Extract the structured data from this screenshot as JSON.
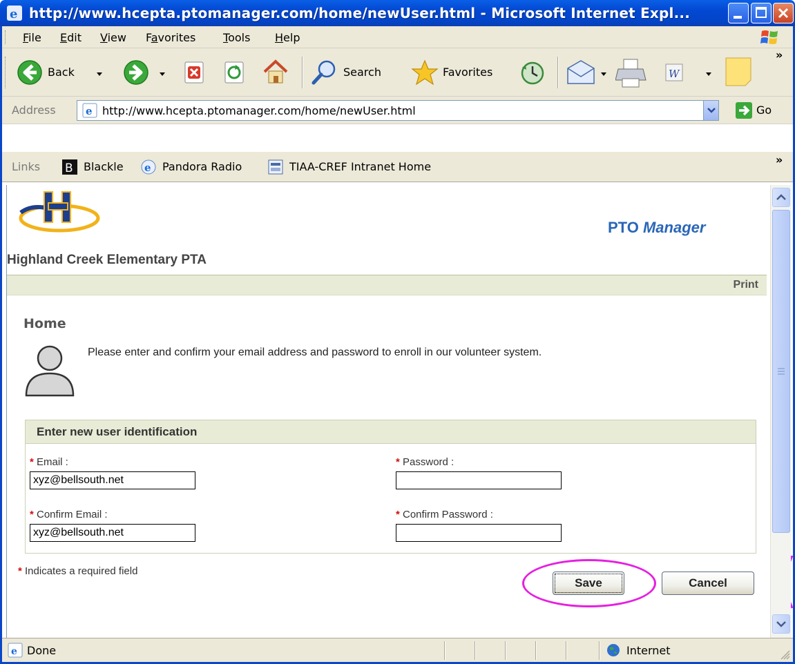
{
  "window": {
    "title": "http://www.hcepta.ptomanager.com/home/newUser.html - Microsoft Internet Expl..."
  },
  "menu": {
    "file": "F",
    "file_rest": "ile",
    "edit": "E",
    "edit_rest": "dit",
    "view": "V",
    "view_rest": "iew",
    "favorites_pre": "F",
    "favorites": "a",
    "favorites_rest": "vorites",
    "tools": "T",
    "tools_rest": "ools",
    "help": "H",
    "help_rest": "elp"
  },
  "toolbar": {
    "back_label": "Back",
    "search_label": "Search",
    "favorites_label": "Favorites"
  },
  "address": {
    "label": "Address",
    "url": "http://www.hcepta.ptomanager.com/home/newUser.html",
    "go_label": "Go"
  },
  "links": {
    "label": "Links",
    "items": [
      "Blackle",
      "Pandora Radio",
      "TIAA-CREF Intranet  Home"
    ]
  },
  "page": {
    "org_name": "Highland Creek Elementary PTA",
    "brand_pto": "PTO",
    "brand_manager": "Manager",
    "print_label": "Print",
    "heading": "Home",
    "intro": "Please enter and confirm your email address and password to enroll in our volunteer system."
  },
  "form": {
    "header": "Enter new user identification",
    "required_marker": "*",
    "email_label": " Email :",
    "email_value": "xyz@bellsouth.net",
    "confirm_email_label": " Confirm Email :",
    "confirm_email_value": "xyz@bellsouth.net",
    "password_label": " Password :",
    "password_value": "",
    "confirm_password_label": " Confirm Password :",
    "confirm_password_value": "",
    "required_note": " Indicates a required field",
    "save_label": "Save",
    "cancel_label": "Cancel"
  },
  "status": {
    "text": "Done",
    "zone": "Internet"
  },
  "colors": {
    "titlebar": "#0348d2",
    "chrome": "#ece9d8",
    "brand_blue": "#2a66b8",
    "section_bg": "#e8ecd6",
    "required": "#d01010",
    "highlight": "#e520e0"
  }
}
